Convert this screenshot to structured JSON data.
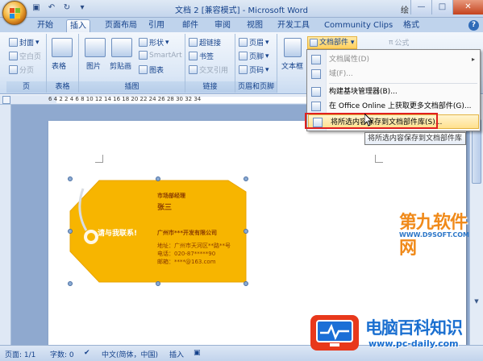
{
  "window": {
    "title": "文档 2 [兼容模式] - Microsoft Word",
    "user": "绘"
  },
  "tabs": [
    "开始",
    "插入",
    "页面布局",
    "引用",
    "邮件",
    "审阅",
    "视图",
    "开发工具",
    "Community Clips",
    "格式"
  ],
  "active_tab": "插入",
  "ribbon": {
    "pages": {
      "cover": "封面",
      "blank": "空白页",
      "break": "分页",
      "label": "页"
    },
    "table": {
      "btn": "表格",
      "label": "表格"
    },
    "illustrations": {
      "picture": "图片",
      "clipart": "剪贴画",
      "shapes": "形状",
      "smartart": "SmartArt",
      "chart": "图表",
      "label": "插图"
    },
    "links": {
      "hyperlink": "超链接",
      "bookmark": "书签",
      "crossref": "交叉引用",
      "label": "链接"
    },
    "header_footer": {
      "header": "页眉",
      "footer": "页脚",
      "page_number": "页码",
      "label": "页眉和页脚"
    },
    "text": {
      "textbox": "文本框",
      "quickparts": "文档部件",
      "formula": "公式"
    }
  },
  "ruler": {
    "numbers": "6  4  2     2  4  6  8  10  12  14  16  18  20  22  24  26  28  30  32  34"
  },
  "menu": {
    "items": [
      {
        "label": "文档属性(D)",
        "enabled": false,
        "submenu": true
      },
      {
        "label": "域(F)...",
        "enabled": false,
        "submenu": false
      },
      {
        "label": "构建基块管理器(B)...",
        "enabled": true,
        "submenu": false
      },
      {
        "label": "在 Office Online 上获取更多文档部件(G)...",
        "enabled": true,
        "submenu": false
      },
      {
        "label": "将所选内容保存到文档部件库(S)...",
        "enabled": true,
        "submenu": false,
        "highlighted": true
      }
    ],
    "tooltip": "将所选内容保存到文档部件库"
  },
  "card": {
    "dept": "市场部经理",
    "name": "张三",
    "company": "广州市***开发有限公司",
    "address": "地址：广州市天河区**路**号",
    "phone": "电话：020-87*****90",
    "email": "邮箱：****@163.com",
    "slogan": "请与我联系!"
  },
  "status": {
    "page": "页面: 1/1",
    "words": "字数: 0",
    "language": "中文(简体，中国)",
    "mode": "插入"
  },
  "watermarks": {
    "site1": "第九软件网",
    "site1_url": "WWW.D9SOFT.COM",
    "site2": "电脑百科知识",
    "site2_url": "www.pc-daily.com"
  },
  "colors": {
    "tag": "#f7b500",
    "accent": "#e02020",
    "brand_blue": "#1a6fd0"
  }
}
